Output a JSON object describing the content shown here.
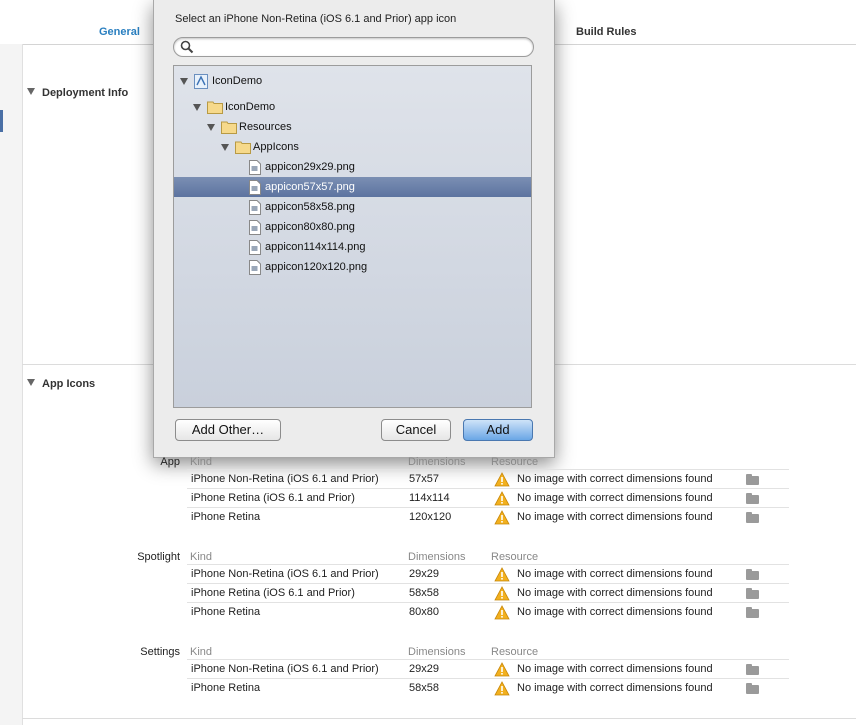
{
  "tabs": [
    {
      "label": "General",
      "selected": true
    },
    {
      "label": "Build Rules",
      "selected": false
    }
  ],
  "sections": {
    "deployment": {
      "title": "Deployment Info"
    },
    "app_icons": {
      "title": "App Icons"
    }
  },
  "icon_table": {
    "headers": {
      "kind": "Kind",
      "dimensions": "Dimensions",
      "resource": "Resource"
    },
    "groups": [
      {
        "label": "App",
        "rows": [
          {
            "kind": "iPhone Non-Retina (iOS 6.1 and Prior)",
            "dimensions": "57x57",
            "resource": "No image with correct dimensions found"
          },
          {
            "kind": "iPhone Retina (iOS 6.1 and Prior)",
            "dimensions": "114x114",
            "resource": "No image with correct dimensions found"
          },
          {
            "kind": "iPhone Retina",
            "dimensions": "120x120",
            "resource": "No image with correct dimensions found"
          }
        ]
      },
      {
        "label": "Spotlight",
        "rows": [
          {
            "kind": "iPhone Non-Retina (iOS 6.1 and Prior)",
            "dimensions": "29x29",
            "resource": "No image with correct dimensions found"
          },
          {
            "kind": "iPhone Retina (iOS 6.1 and Prior)",
            "dimensions": "58x58",
            "resource": "No image with correct dimensions found"
          },
          {
            "kind": "iPhone Retina",
            "dimensions": "80x80",
            "resource": "No image with correct dimensions found"
          }
        ]
      },
      {
        "label": "Settings",
        "rows": [
          {
            "kind": "iPhone Non-Retina (iOS 6.1 and Prior)",
            "dimensions": "29x29",
            "resource": "No image with correct dimensions found"
          },
          {
            "kind": "iPhone Retina",
            "dimensions": "58x58",
            "resource": "No image with correct dimensions found"
          }
        ]
      }
    ]
  },
  "dialog": {
    "prompt": "Select an iPhone Non-Retina (iOS 6.1 and Prior) app icon",
    "search_value": "",
    "tree": [
      {
        "label": "IconDemo",
        "type": "project",
        "expanded": true
      },
      {
        "label": "IconDemo",
        "type": "folder",
        "expanded": true
      },
      {
        "label": "Resources",
        "type": "folder",
        "expanded": true
      },
      {
        "label": "AppIcons",
        "type": "folder",
        "expanded": true
      },
      {
        "label": "appicon29x29.png",
        "type": "file"
      },
      {
        "label": "appicon57x57.png",
        "type": "file",
        "selected": true
      },
      {
        "label": "appicon58x58.png",
        "type": "file"
      },
      {
        "label": "appicon80x80.png",
        "type": "file"
      },
      {
        "label": "appicon114x114.png",
        "type": "file"
      },
      {
        "label": "appicon120x120.png",
        "type": "file"
      }
    ],
    "buttons": {
      "add_other": "Add Other…",
      "cancel": "Cancel",
      "add": "Add"
    }
  }
}
